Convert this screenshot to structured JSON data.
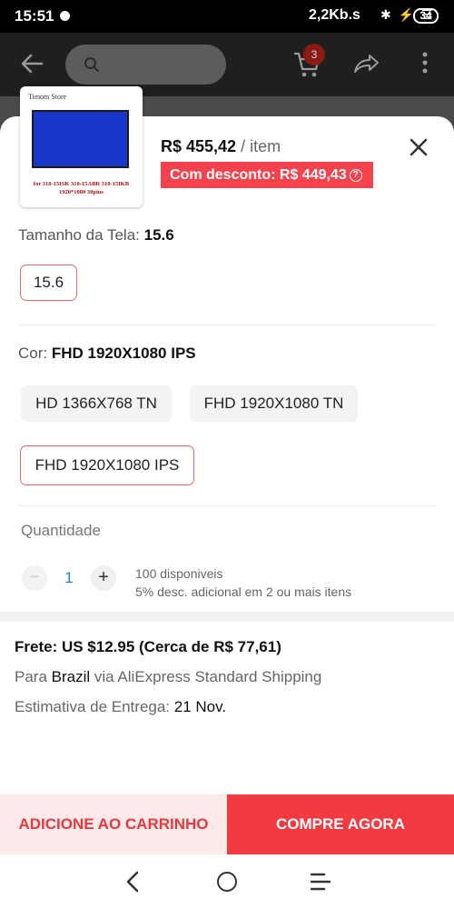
{
  "status_bar": {
    "time": "15:51",
    "network_speed": "2,2Kb.s",
    "battery": "34",
    "icons": [
      "notification-icon",
      "bluetooth-icon",
      "data-icon",
      "wifi-icon"
    ]
  },
  "header": {
    "cart_badge": "3",
    "icons": [
      "back-arrow-icon",
      "search-icon",
      "cart-icon",
      "share-icon",
      "more-icon"
    ]
  },
  "product": {
    "thumbnail": {
      "store_name": "Timom Store",
      "caption_line1": "for 310-15ISK 310-15ABR 310-15IKB",
      "caption_line2": "1920*1080 30pins"
    },
    "price": "R$ 455,42",
    "price_unit": "/ item",
    "discount_text": "Com desconto: R$ 449,43",
    "help_icon": "?"
  },
  "screen_size": {
    "label": "Tamanho da Tela:",
    "selected": "15.6",
    "options": [
      "15.6"
    ]
  },
  "color": {
    "label": "Cor:",
    "selected": "FHD 1920X1080 IPS",
    "options": [
      "HD 1366X768 TN",
      "FHD 1920X1080 TN",
      "FHD 1920X1080 IPS"
    ]
  },
  "quantity": {
    "label": "Quantidade",
    "minus": "−",
    "value": "1",
    "plus": "+",
    "available": "100 disponiveis",
    "extra_discount": "5% desc. adicional em 2 ou mais itens"
  },
  "shipping": {
    "title": "Frete: US $12.95 (Cerca de R$ 77,61)",
    "to_prefix": "Para",
    "country": "Brazil",
    "via": "via AliExpress Standard Shipping",
    "estimate_label": "Estimativa de Entrega:",
    "estimate_date": "21 Nov."
  },
  "actions": {
    "add_to_cart": "ADICIONE AO CARRINHO",
    "buy_now": "COMPRE AGORA"
  },
  "colors": {
    "accent_red": "#f23b41",
    "cart_button_bg": "#fde9e9",
    "selected_border": "#e46a6a",
    "quantity_blue": "#1e7fd8"
  }
}
